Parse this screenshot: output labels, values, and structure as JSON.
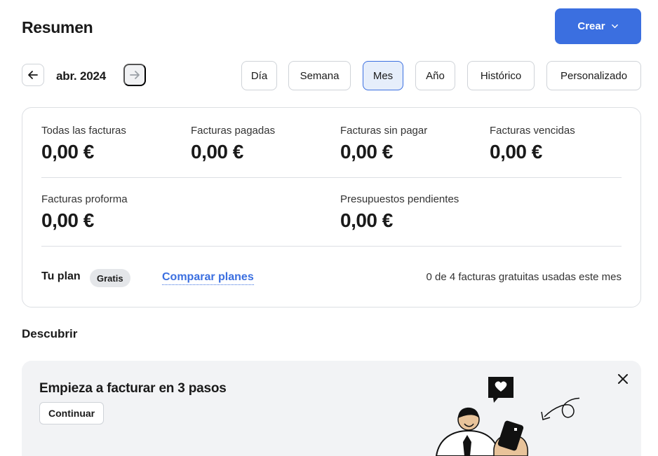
{
  "header": {
    "title": "Resumen",
    "create_label": "Crear"
  },
  "period": {
    "label": "abr. 2024",
    "ranges": [
      {
        "label": "Día",
        "active": false
      },
      {
        "label": "Semana",
        "active": false
      },
      {
        "label": "Mes",
        "active": true
      },
      {
        "label": "Año",
        "active": false
      },
      {
        "label": "Histórico",
        "active": false
      },
      {
        "label": "Personalizado",
        "active": false
      }
    ]
  },
  "summary": {
    "stats": [
      {
        "label": "Todas las facturas",
        "value": "0,00 €"
      },
      {
        "label": "Facturas pagadas",
        "value": "0,00 €"
      },
      {
        "label": "Facturas sin pagar",
        "value": "0,00 €"
      },
      {
        "label": "Facturas vencidas",
        "value": "0,00 €"
      },
      {
        "label": "Facturas proforma",
        "value": "0,00 €"
      },
      {
        "label": "Presupuestos pendientes",
        "value": "0,00 €"
      }
    ],
    "plan": {
      "label": "Tu plan",
      "badge": "Gratis",
      "compare_label": "Comparar planes",
      "usage": "0 de 4 facturas gratuitas usadas este mes"
    }
  },
  "discover": {
    "title": "Descubrir",
    "promo": {
      "title": "Empieza a facturar en 3 pasos",
      "continue_label": "Continuar"
    }
  },
  "colors": {
    "accent": "#3b6fe0",
    "active_bg": "#e6eefb",
    "card_bg": "#f2f3f5",
    "skin": "#e8c39a"
  },
  "icons": {
    "prev": "arrow-left-icon",
    "next": "arrow-right-icon",
    "dropdown": "chevron-down-icon",
    "close": "close-icon"
  }
}
